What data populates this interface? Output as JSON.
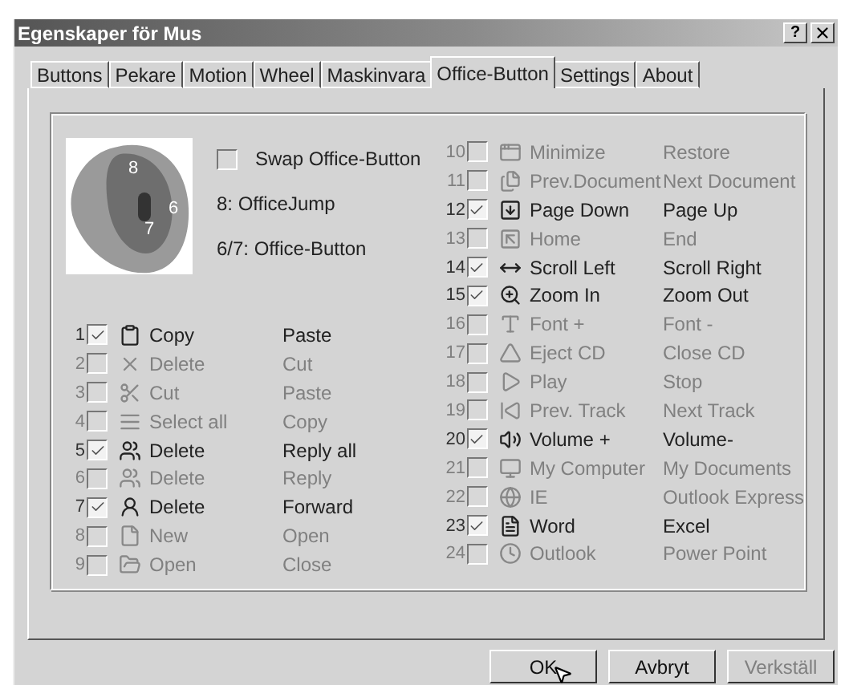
{
  "window": {
    "title": "Egenskaper för Mus",
    "help": "?"
  },
  "tabs": [
    {
      "label": "Buttons",
      "selected": false
    },
    {
      "label": "Pekare",
      "selected": false
    },
    {
      "label": "Motion",
      "selected": false
    },
    {
      "label": "Wheel",
      "selected": false
    },
    {
      "label": "Maskinvara",
      "selected": false
    },
    {
      "label": "Office-Button",
      "selected": true
    },
    {
      "label": "Settings",
      "selected": false
    },
    {
      "label": "About",
      "selected": false
    }
  ],
  "mouse_image": {
    "labels": [
      "8",
      "6",
      "7"
    ]
  },
  "swap": {
    "label": "Swap Office-Button",
    "checked": false
  },
  "info": [
    "8: OfficeJump",
    "6/7: Office-Button"
  ],
  "left_rows": [
    {
      "number": "1",
      "checked": true,
      "label": "Copy",
      "action": "Paste"
    },
    {
      "number": "2",
      "checked": false,
      "label": "Delete",
      "action": "Cut"
    },
    {
      "number": "3",
      "checked": false,
      "label": "Cut",
      "action": "Paste"
    },
    {
      "number": "4",
      "checked": false,
      "label": "Select all",
      "action": "Copy"
    },
    {
      "number": "5",
      "checked": true,
      "label": "Delete",
      "action": "Reply all"
    },
    {
      "number": "6",
      "checked": false,
      "label": "Delete",
      "action": "Reply"
    },
    {
      "number": "7",
      "checked": true,
      "label": "Delete",
      "action": "Forward"
    },
    {
      "number": "8",
      "checked": false,
      "label": "New",
      "action": "Open"
    },
    {
      "number": "9",
      "checked": false,
      "label": "Open",
      "action": "Close"
    }
  ],
  "right_rows": [
    {
      "number": "10",
      "checked": false,
      "label": "Minimize",
      "action": "Restore"
    },
    {
      "number": "11",
      "checked": false,
      "label": "Prev.Document",
      "action": "Next Document"
    },
    {
      "number": "12",
      "checked": true,
      "label": "Page Down",
      "action": "Page Up"
    },
    {
      "number": "13",
      "checked": false,
      "label": "Home",
      "action": "End"
    },
    {
      "number": "14",
      "checked": true,
      "label": "Scroll Left",
      "action": "Scroll Right"
    },
    {
      "number": "15",
      "checked": true,
      "label": "Zoom In",
      "action": "Zoom Out"
    },
    {
      "number": "16",
      "checked": false,
      "label": "Font +",
      "action": "Font -"
    },
    {
      "number": "17",
      "checked": false,
      "label": "Eject CD",
      "action": "Close CD"
    },
    {
      "number": "18",
      "checked": false,
      "label": "Play",
      "action": "Stop"
    },
    {
      "number": "19",
      "checked": false,
      "label": "Prev. Track",
      "action": "Next Track"
    },
    {
      "number": "20",
      "checked": true,
      "label": "Volume +",
      "action": "Volume-"
    },
    {
      "number": "21",
      "checked": false,
      "label": "My Computer",
      "action": "My Documents"
    },
    {
      "number": "22",
      "checked": false,
      "label": "IE",
      "action": "Outlook Express"
    },
    {
      "number": "23",
      "checked": true,
      "label": "Word",
      "action": "Excel"
    },
    {
      "number": "24",
      "checked": false,
      "label": "Outlook",
      "action": "Power Point"
    }
  ],
  "buttons": [
    {
      "label": "OK",
      "disabled": false
    },
    {
      "label": "Avbryt",
      "disabled": false
    },
    {
      "label": "Verkställ",
      "disabled": true
    }
  ]
}
